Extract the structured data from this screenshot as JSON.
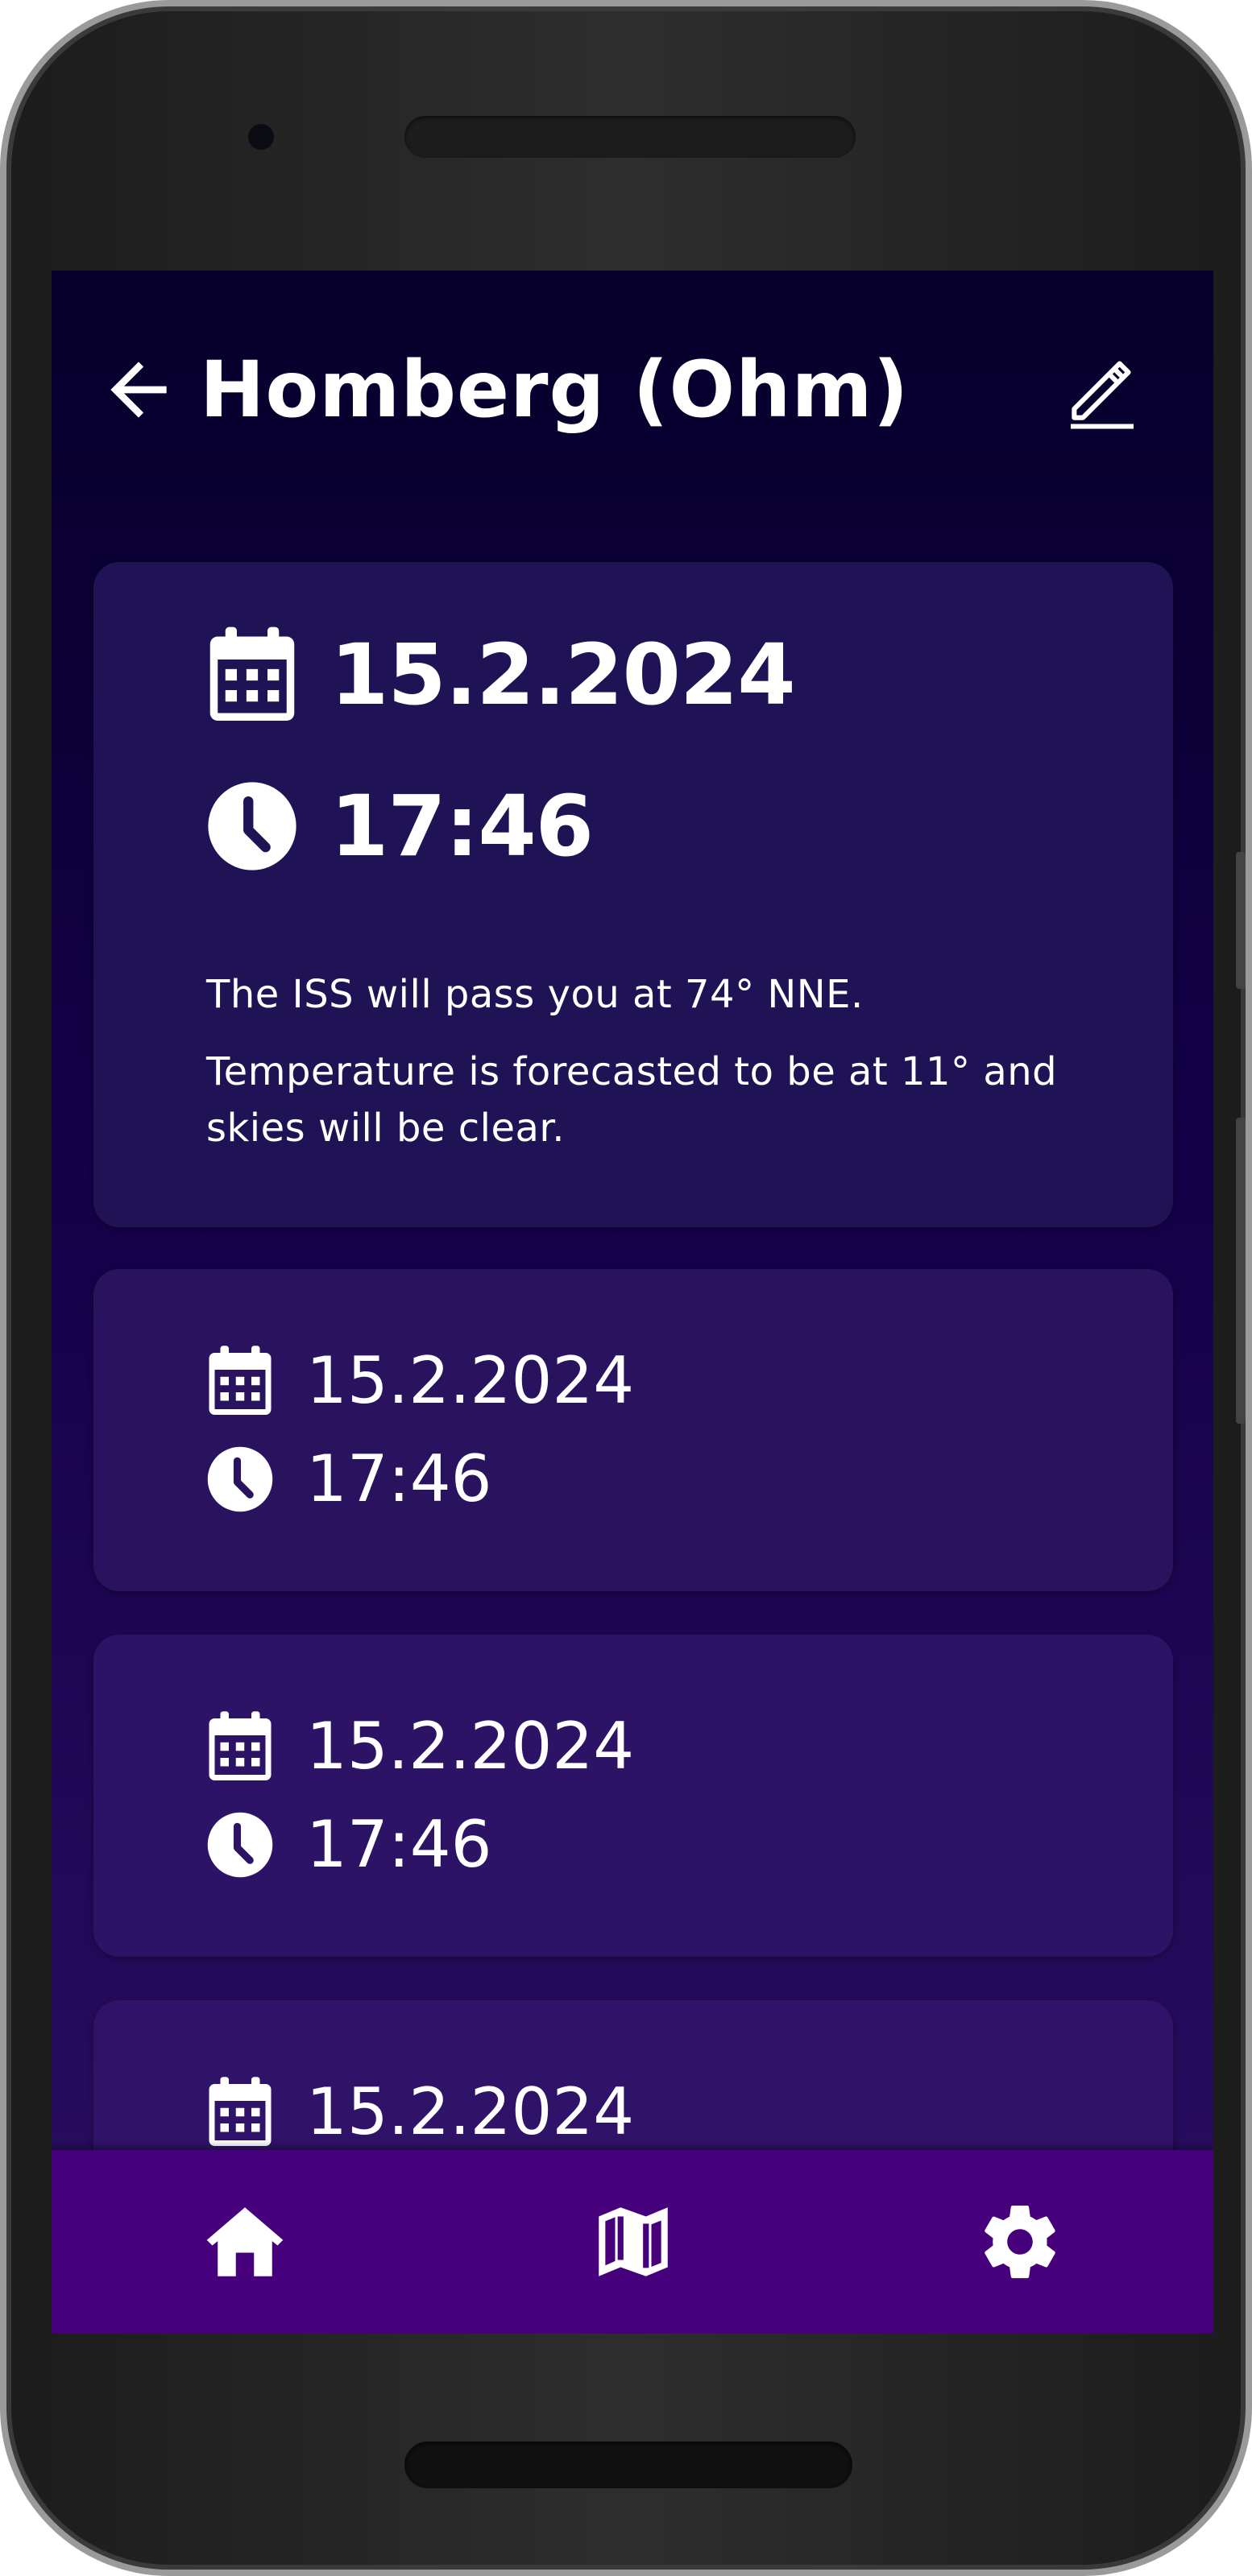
{
  "header": {
    "title": "Homberg (Ohm)",
    "back_icon": "arrow-left-icon",
    "edit_icon": "pencil-icon"
  },
  "passes": [
    {
      "date": "15.2.2024",
      "time": "17:46",
      "description": "The ISS will pass you at 74° NNE.",
      "forecast": "Temperature is forecasted to be at 11° and skies will be clear."
    },
    {
      "date": "15.2.2024",
      "time": "17:46"
    },
    {
      "date": "15.2.2024",
      "time": "17:46"
    },
    {
      "date": "15.2.2024"
    }
  ],
  "icons": {
    "date": "calendar-icon",
    "time": "clock-icon"
  },
  "nav": [
    {
      "icon": "home-icon"
    },
    {
      "icon": "map-icon"
    },
    {
      "icon": "gear-icon"
    }
  ],
  "colors": {
    "background_top": "#06002a",
    "background_bottom": "#2b0f62",
    "card": "#1f1356",
    "nav_bar": "#47007b",
    "text": "#ffffff"
  }
}
